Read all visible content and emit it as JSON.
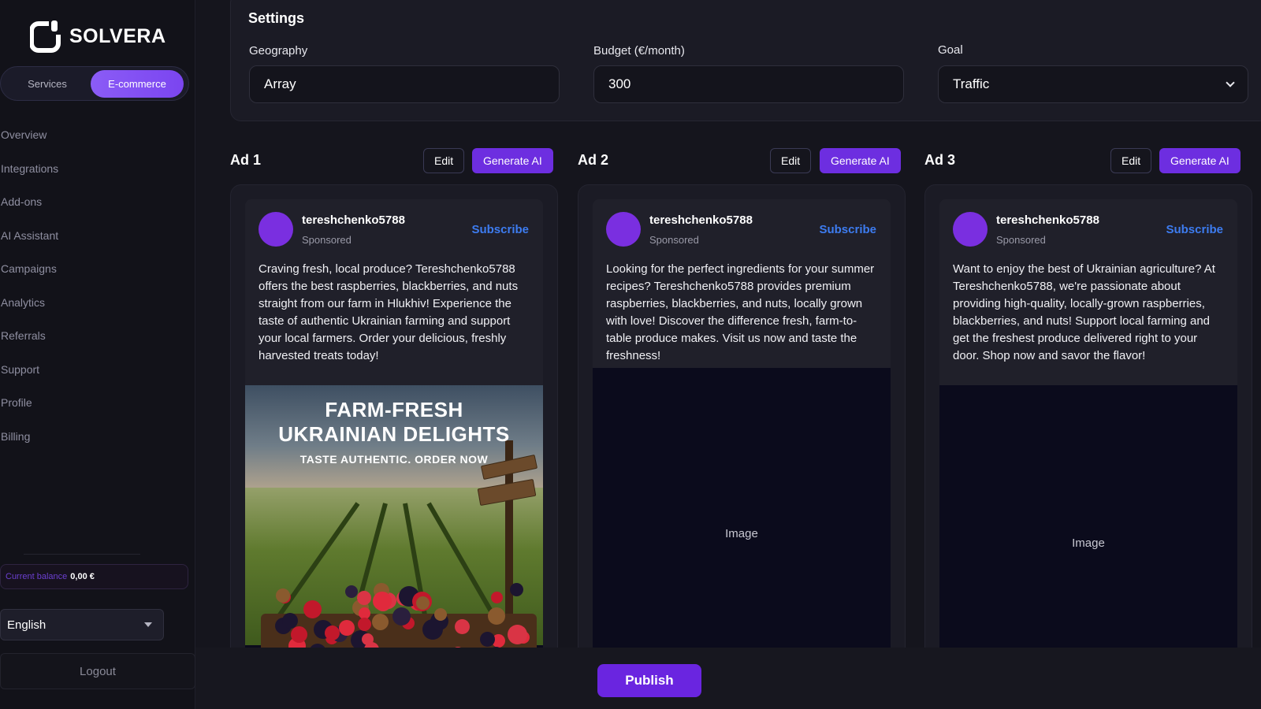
{
  "brand": {
    "name": "SOLVERA"
  },
  "sidebar": {
    "modes": [
      {
        "label": "Services",
        "active": false
      },
      {
        "label": "E-commerce",
        "active": true
      }
    ],
    "nav": [
      "Overview",
      "Integrations",
      "Add-ons",
      "AI Assistant",
      "Campaigns",
      "Analytics",
      "Referrals",
      "Support",
      "Profile",
      "Billing"
    ],
    "balance_label": "Current balance",
    "balance_value": "0,00 €",
    "language": "English",
    "logout": "Logout"
  },
  "settings": {
    "title": "Settings",
    "geography_label": "Geography",
    "geography_value": "Array",
    "budget_label": "Budget (€/month)",
    "budget_value": "300",
    "goal_label": "Goal",
    "goal_value": "Traffic"
  },
  "ads": [
    {
      "title": "Ad 1",
      "edit_label": "Edit",
      "generate_label": "Generate AI",
      "username": "tereshchenko5788",
      "sponsored": "Sponsored",
      "subscribe": "Subscribe",
      "text": "Craving fresh, local produce? Tereshchenko5788 offers the best raspberries, blackberries, and nuts straight from our farm in Hlukhiv! Experience the taste of authentic Ukrainian farming and support your local farmers. Order your delicious, freshly harvested treats today!",
      "image": {
        "headline_1": "FARM-FRESH",
        "headline_2": "UKRAINIAN DELIGHTS",
        "subline": "TASTE AUTHENTIC. ORDER NOW"
      }
    },
    {
      "title": "Ad 2",
      "edit_label": "Edit",
      "generate_label": "Generate AI",
      "username": "tereshchenko5788",
      "sponsored": "Sponsored",
      "subscribe": "Subscribe",
      "text": "Looking for the perfect ingredients for your summer recipes? Tereshchenko5788 provides premium raspberries, blackberries, and nuts, locally grown with love! Discover the difference fresh, farm-to-table produce makes. Visit us now and taste the freshness!",
      "image_placeholder": "Image"
    },
    {
      "title": "Ad 3",
      "edit_label": "Edit",
      "generate_label": "Generate AI",
      "username": "tereshchenko5788",
      "sponsored": "Sponsored",
      "subscribe": "Subscribe",
      "text": "Want to enjoy the best of Ukrainian agriculture? At Tereshchenko5788, we're passionate about providing high-quality, locally-grown raspberries, blackberries, and nuts! Support local farming and get the freshest produce delivered right to your door. Shop now and savor the flavor!",
      "image_placeholder": "Image"
    }
  ],
  "publish_label": "Publish"
}
